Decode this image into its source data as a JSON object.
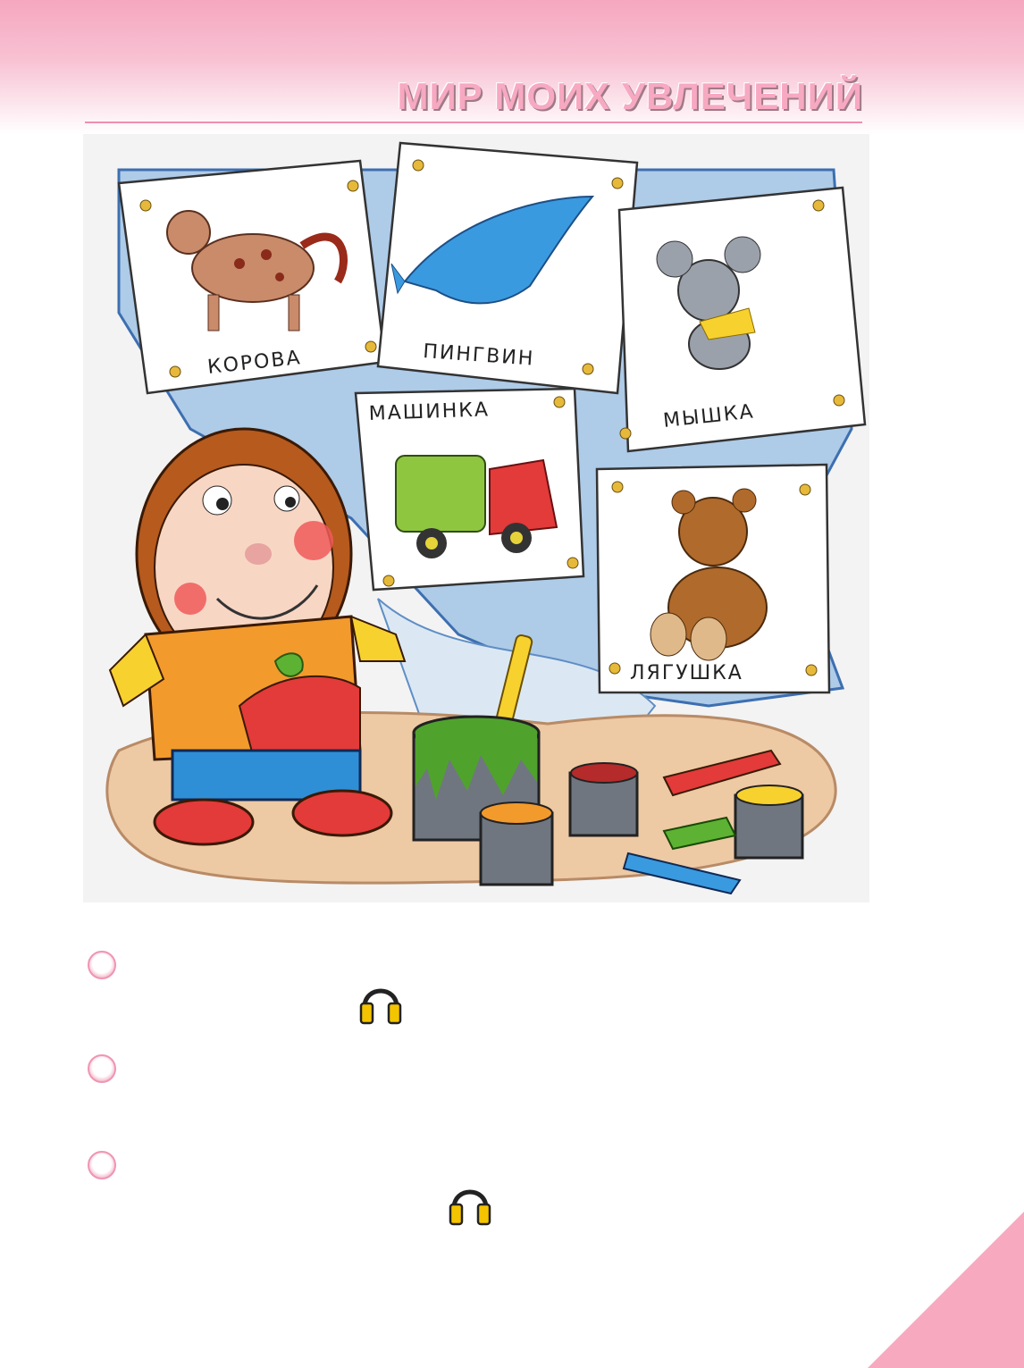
{
  "header": {
    "title": "МИР  МОИХ  УВЛЕЧЕНИЙ"
  },
  "illustration": {
    "cards": [
      {
        "id": "horse",
        "label": "КОРОВА"
      },
      {
        "id": "dolphin",
        "label": "ПИНГВИН"
      },
      {
        "id": "mouse",
        "label": "МЫШКА"
      },
      {
        "id": "truck",
        "label": "МАШИНКА"
      },
      {
        "id": "bear",
        "label": "ЛЯГУШКА"
      }
    ]
  },
  "exercises": [
    {
      "bullet": "circle-bullet",
      "icon": "headphones-icon"
    },
    {
      "bullet": "circle-bullet"
    },
    {
      "bullet": "circle-bullet",
      "icon": "headphones-icon"
    }
  ],
  "colors": {
    "accent": "#f7a9c2",
    "rule": "#ef8fae",
    "headphones": "#f5c400"
  }
}
